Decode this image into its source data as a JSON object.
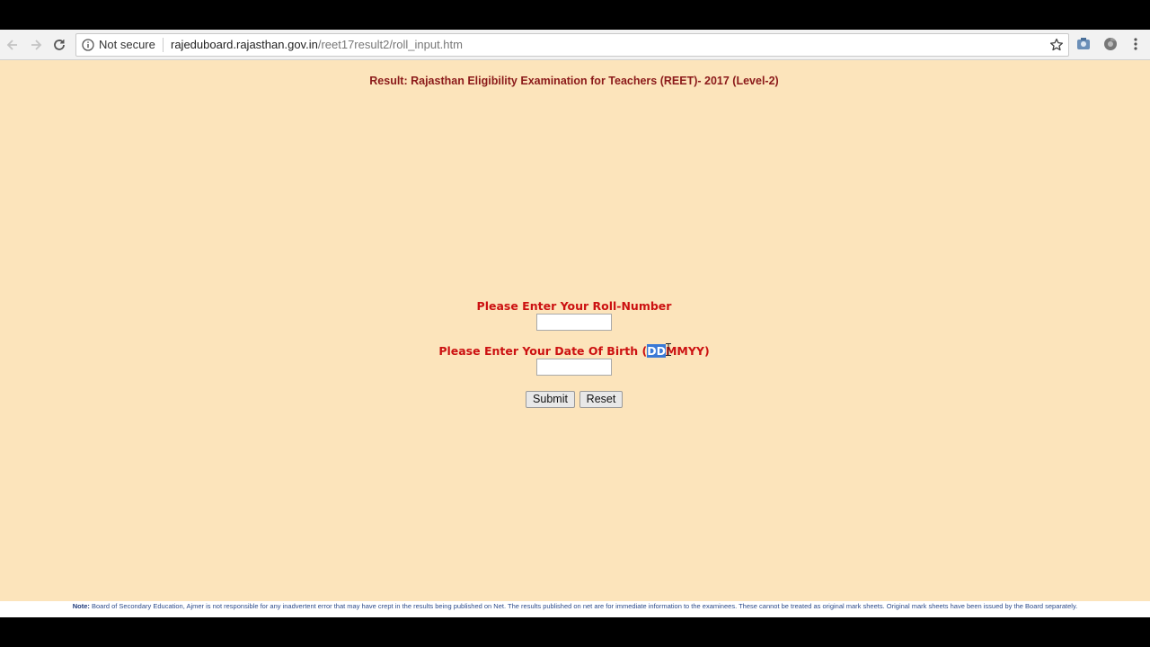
{
  "browser": {
    "security_label": "Not secure",
    "url_host": "rajeduboard.rajasthan.gov.in",
    "url_path": "/reet17result2/roll_input.htm",
    "icons": {
      "back": "back-arrow-icon",
      "forward": "forward-arrow-icon",
      "reload": "reload-icon",
      "info": "info-icon",
      "bookmark": "star-icon",
      "extension_1": "extension-icon",
      "extension_2": "extension-icon",
      "menu": "kebab-menu-icon"
    }
  },
  "page": {
    "background_color": "#fce4bb",
    "title": "Result: Rajasthan Eligibility Examination for Teachers (REET)- 2017 (Level-2)",
    "title_color": "#8b1a1a",
    "label_color": "#cc1111",
    "roll_label": "Please Enter Your Roll-Number",
    "roll_value": "",
    "dob_label_prefix": "Please Enter Your Date Of Birth (",
    "dob_label_selected": "DD",
    "dob_label_suffix": "MMYY)",
    "dob_value": "",
    "submit_label": "Submit",
    "reset_label": "Reset",
    "note_label": "Note:",
    "note_text": " Board of Secondary Education, Ajmer is not responsible for any inadvertent error that may have crept in the results being published on Net. The results published on net are for immediate information to the examinees. These cannot be treated as original mark sheets. Original mark sheets have been issued by the Board separately."
  }
}
